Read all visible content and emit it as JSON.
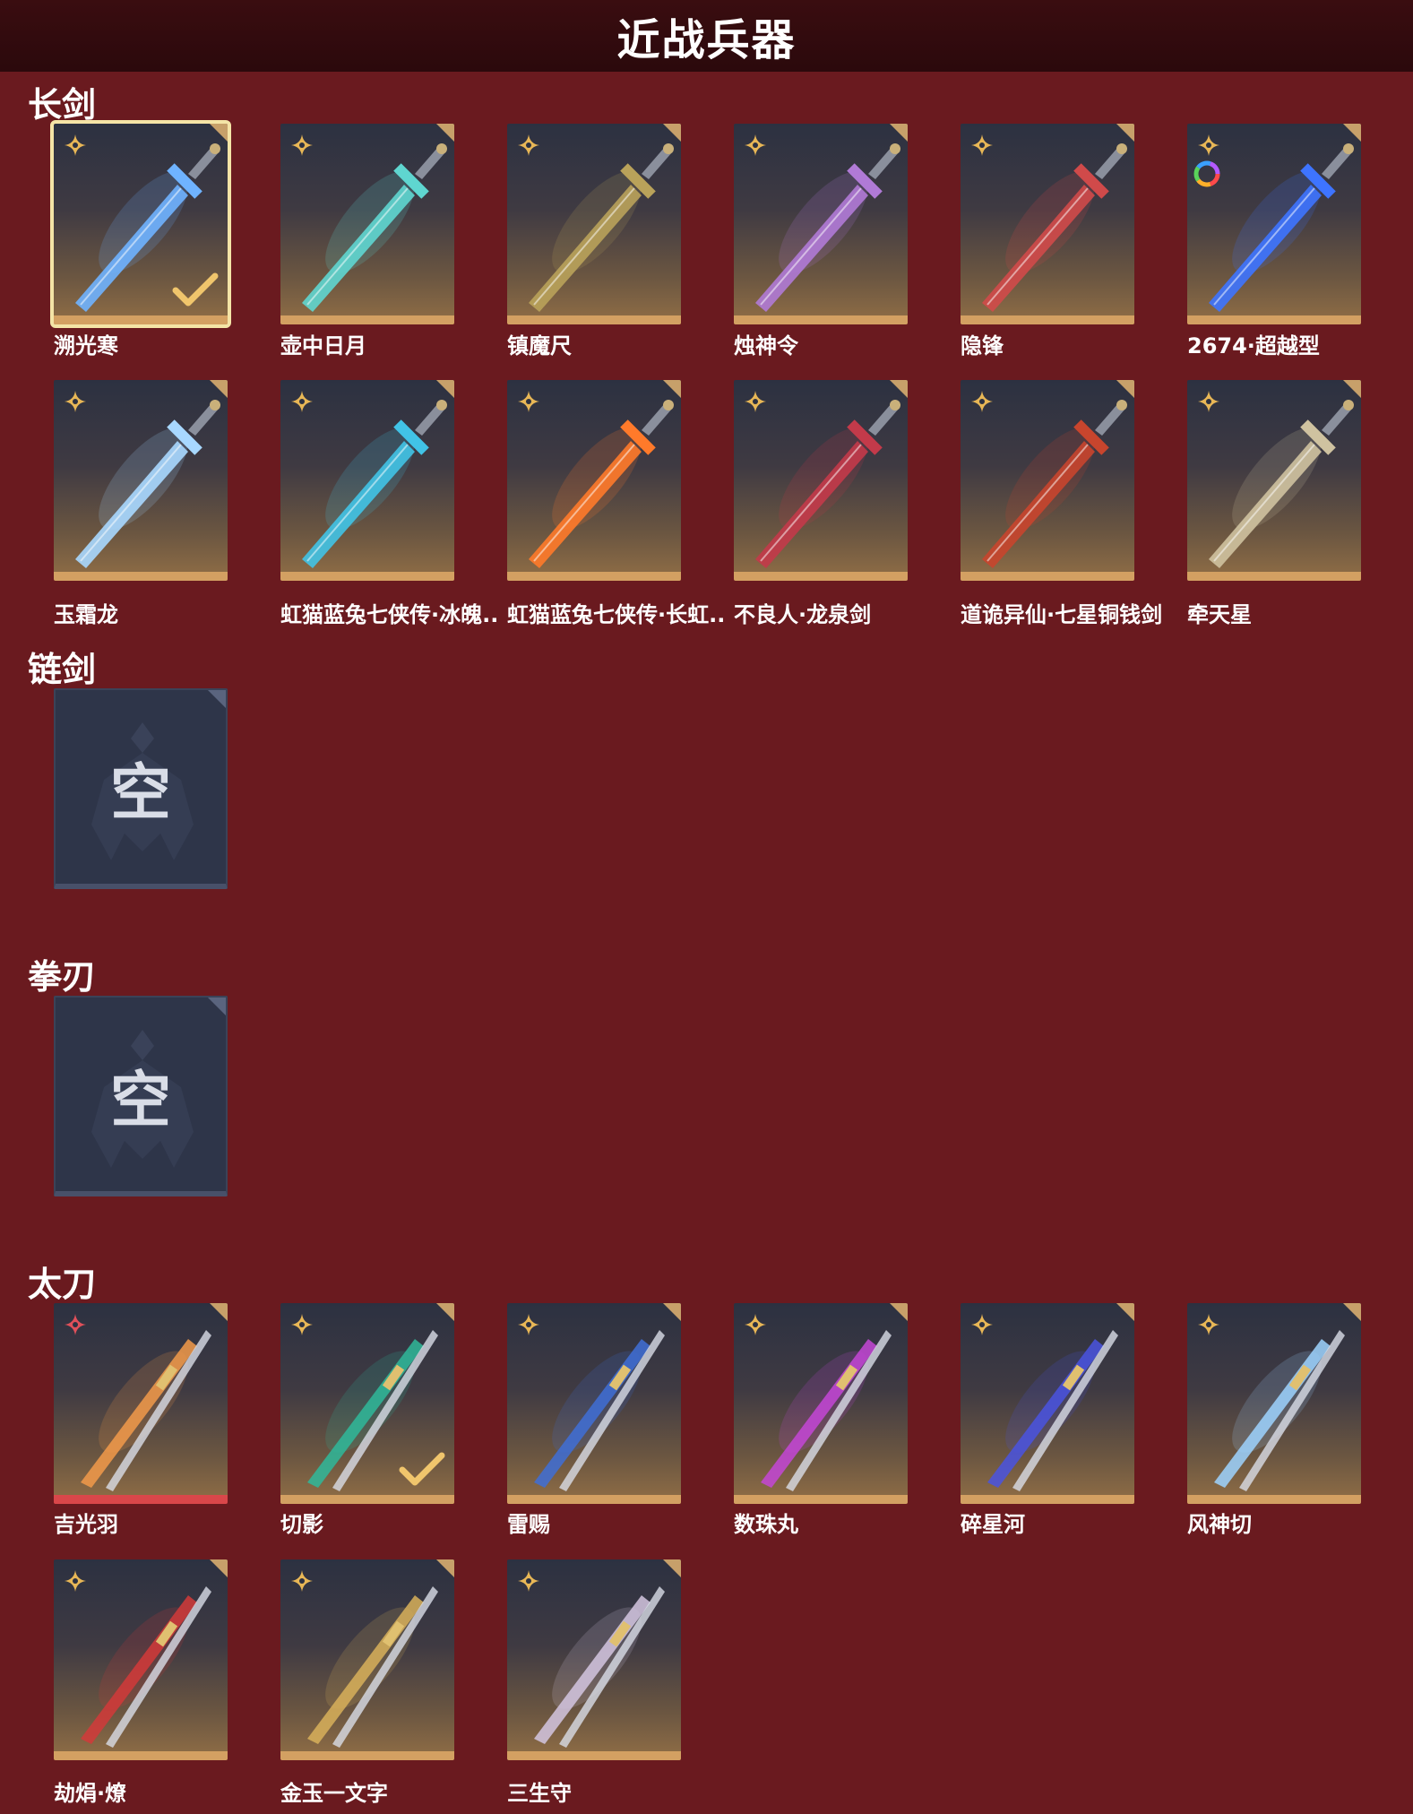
{
  "header": {
    "title": "近战兵器"
  },
  "sections": {
    "longsword": {
      "title": "长剑",
      "items": [
        {
          "name": "溯光寒",
          "rank": "gold",
          "selected": true,
          "equipped": true,
          "color": "#6fb3ff"
        },
        {
          "name": "壶中日月",
          "rank": "gold",
          "color": "#5fd6d0"
        },
        {
          "name": "镇魔尺",
          "rank": "gold",
          "color": "#b9a25a"
        },
        {
          "name": "烛神令",
          "rank": "gold",
          "color": "#b07ad6"
        },
        {
          "name": "隐锋",
          "rank": "gold",
          "color": "#d04a4a"
        },
        {
          "name": "2674·超越型",
          "rank": "gold",
          "ring": true,
          "color": "#3e74ff"
        },
        {
          "name": "玉霜龙",
          "rank": "gold",
          "color": "#a8d8ff"
        },
        {
          "name": "虹猫蓝兔七侠传·冰魄..",
          "rank": "gold",
          "color": "#41c3e6"
        },
        {
          "name": "虹猫蓝兔七侠传·长虹..",
          "rank": "gold",
          "color": "#ff7a2a"
        },
        {
          "name": "不良人·龙泉剑",
          "rank": "gold",
          "color": "#c33a4a"
        },
        {
          "name": "道诡异仙·七星铜钱剑",
          "rank": "gold",
          "color": "#c8452d"
        },
        {
          "name": "牵天星",
          "rank": "gold",
          "color": "#cfc2a0"
        }
      ]
    },
    "chainsword": {
      "title": "链剑",
      "empty_label": "空"
    },
    "fistblade": {
      "title": "拳刃",
      "empty_label": "空"
    },
    "tachi": {
      "title": "太刀",
      "items": [
        {
          "name": "吉光羽",
          "rank": "red",
          "color": "#f29a4a"
        },
        {
          "name": "切影",
          "rank": "gold",
          "equipped": true,
          "color": "#2fb89a"
        },
        {
          "name": "雷赐",
          "rank": "gold",
          "color": "#3f6fd6"
        },
        {
          "name": "数珠丸",
          "rank": "gold",
          "color": "#c446d6"
        },
        {
          "name": "碎星河",
          "rank": "gold",
          "color": "#4a54e0"
        },
        {
          "name": "风神切",
          "rank": "gold",
          "color": "#9ed4ff"
        },
        {
          "name": "劫焆·燎",
          "rank": "gold",
          "color": "#d23a3a"
        },
        {
          "name": "金玉一文字",
          "rank": "gold",
          "color": "#d8b05a"
        },
        {
          "name": "三生守",
          "rank": "gold",
          "color": "#d3c6e0"
        }
      ]
    }
  }
}
